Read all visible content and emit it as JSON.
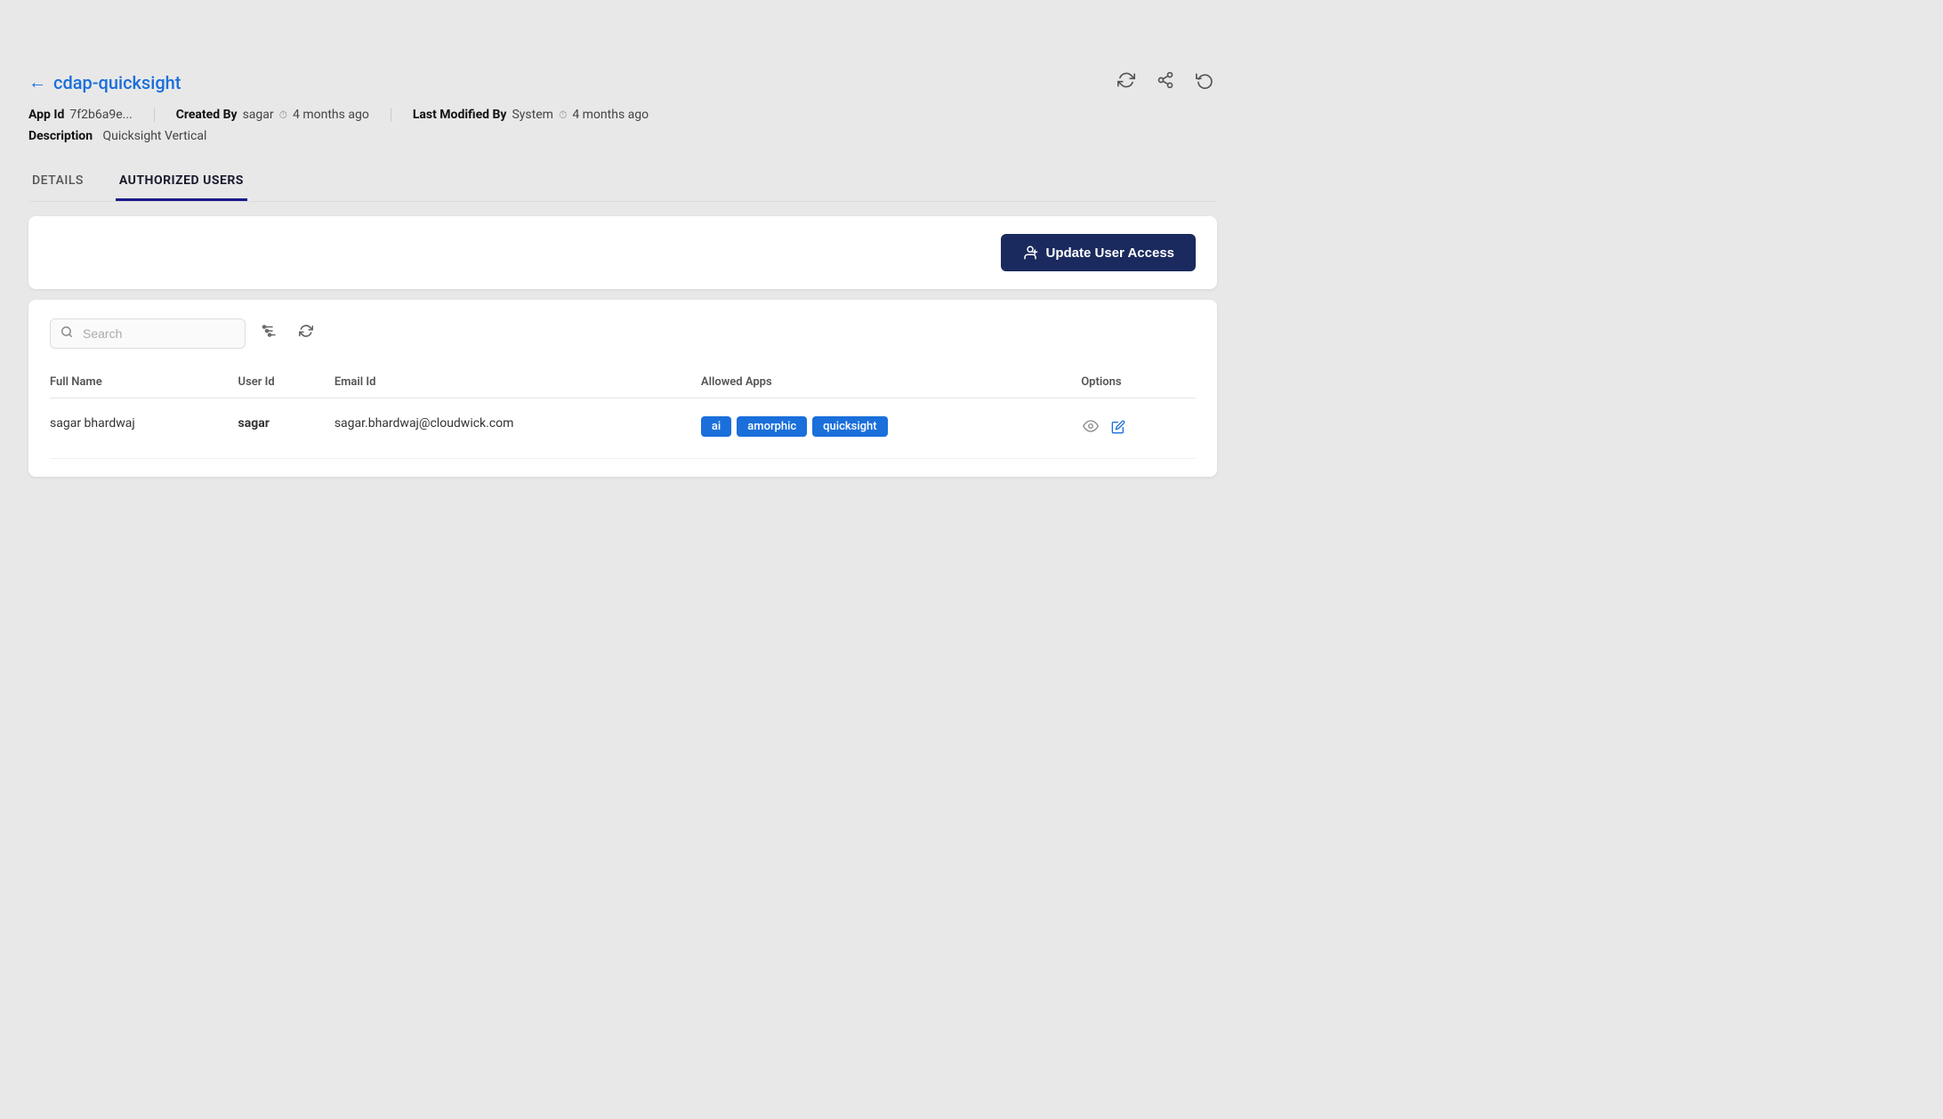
{
  "page": {
    "title": "cdap-quicksight",
    "app_id_label": "App Id",
    "app_id_value": "7f2b6a9e...",
    "created_by_label": "Created By",
    "created_by_value": "sagar",
    "created_ago": "4 months ago",
    "last_modified_label": "Last Modified By",
    "last_modified_value": "System",
    "last_modified_ago": "4 months ago",
    "description_label": "Description",
    "description_value": "Quicksight Vertical"
  },
  "tabs": [
    {
      "id": "details",
      "label": "DETAILS",
      "active": false
    },
    {
      "id": "authorized-users",
      "label": "AUTHORIZED USERS",
      "active": true
    }
  ],
  "action_bar": {
    "update_button_label": "Update User Access",
    "update_button_icon": "👤+"
  },
  "search": {
    "placeholder": "Search"
  },
  "table": {
    "columns": [
      {
        "id": "full_name",
        "label": "Full Name"
      },
      {
        "id": "user_id",
        "label": "User Id"
      },
      {
        "id": "email_id",
        "label": "Email Id"
      },
      {
        "id": "allowed_apps",
        "label": "Allowed Apps"
      },
      {
        "id": "options",
        "label": "Options"
      }
    ],
    "rows": [
      {
        "full_name": "sagar bhardwaj",
        "user_id": "sagar",
        "email_id": "sagar.bhardwaj@cloudwick.com",
        "allowed_apps": [
          "ai",
          "amorphic",
          "quicksight"
        ],
        "options": [
          "view",
          "edit"
        ]
      }
    ]
  },
  "icons": {
    "back_arrow": "←",
    "refresh": "↻",
    "share": "⤴",
    "history": "↺",
    "search": "🔍",
    "filter": "⚙",
    "view": "👁",
    "edit": "✏",
    "cursor": "↖"
  }
}
